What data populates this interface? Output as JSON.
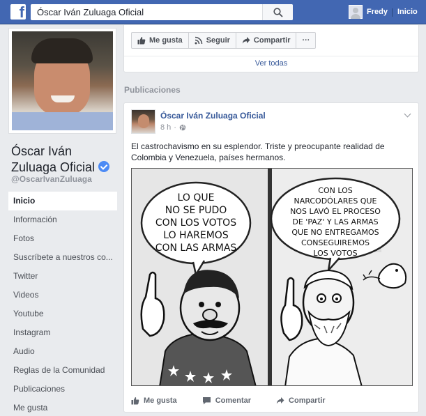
{
  "topbar": {
    "search_value": "Óscar Iván Zuluaga Oficial",
    "user_name": "Fredy",
    "home_label": "Inicio"
  },
  "profile": {
    "page_name": "Óscar Iván Zuluaga Oficial",
    "handle": "@OscarIvanZuluaga"
  },
  "nav": {
    "items": [
      "Inicio",
      "Información",
      "Fotos",
      "Suscríbete a nuestros co...",
      "Twitter",
      "Videos",
      "Youtube",
      "Instagram",
      "Audio",
      "Reglas de la Comunidad",
      "Publicaciones",
      "Me gusta"
    ],
    "active_index": 0
  },
  "page_actions": {
    "like": "Me gusta",
    "follow": "Seguir",
    "share": "Compartir",
    "more": "···",
    "see_all": "Ver todas"
  },
  "section_title": "Publicaciones",
  "post": {
    "author": "Óscar Iván Zuluaga Oficial",
    "time": "8 h",
    "text": "El castrochavismo en su esplendor. Triste y preocupante realidad de Colombia y Venezuela, países hermanos.",
    "comic": {
      "left_bubble": [
        "LO QUE",
        "NO SE PUDO",
        "CON LOS VOTOS",
        "LO HAREMOS",
        "CON LAS ARMAS"
      ],
      "right_bubble": [
        "CON LOS",
        "NARCODÓLARES QUE",
        "NOS LAVÓ EL PROCESO",
        "DE 'PAZ' Y LAS ARMAS",
        "QUE NO ENTREGAMOS",
        "CONSEGUIREMOS",
        "LOS VOTOS"
      ]
    },
    "actions": {
      "like": "Me gusta",
      "comment": "Comentar",
      "share": "Compartir"
    }
  },
  "colors": {
    "brand": "#4267b2",
    "link": "#365899",
    "background": "#e9ebee"
  }
}
